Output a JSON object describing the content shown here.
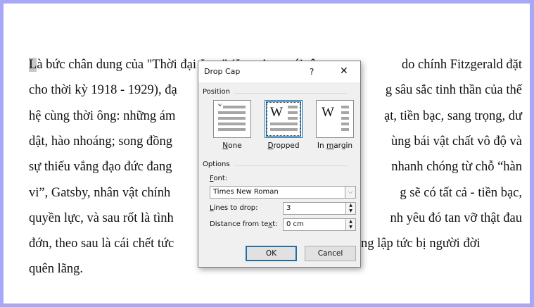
{
  "document": {
    "drop_cap_letter": "L",
    "lines": [
      {
        "left": "à bức chân dung của \"Thời đại Jazz\" (Jazz Age, cái tên",
        "right": "do chính Fitzgerald đặt"
      },
      {
        "left": "cho thời kỳ 1918 - 1929), đạ",
        "right": "g sâu sắc tinh thần của thế"
      },
      {
        "left": "hệ cùng thời ông: những ám",
        "right": "ạt, tiền bạc, sang trọng, dư"
      },
      {
        "left": "dật, hào nhoáng; song đồng",
        "right": "ùng bái vật chất vô độ và"
      },
      {
        "left": "sự thiếu vắng đạo đức đang",
        "right": "nhanh chóng từ chỗ “hàn"
      },
      {
        "left": "vi”, Gatsby, nhân vật chính",
        "right": "g sẽ có tất cả - tiền bạc,"
      },
      {
        "left": "quyền lực, và sau rốt là  tình",
        "right": "nh yêu đó tan vỡ thật đau"
      },
      {
        "left": "đớn, theo sau là cái chết tức",
        "right": "ng lập tức bị người đời"
      },
      {
        "left": "quên lãng.",
        "right": ""
      }
    ]
  },
  "dialog": {
    "title": "Drop Cap",
    "help": "?",
    "close": "✕",
    "position_label": "Position",
    "positions": [
      {
        "label": "None",
        "key": "N",
        "rest": "one"
      },
      {
        "label": "Dropped",
        "key": "D",
        "rest": "ropped"
      },
      {
        "label": "In margin",
        "pre": "In ",
        "key": "m",
        "rest": "argin"
      }
    ],
    "selected_position": "Dropped",
    "options_label": "Options",
    "font_label_key": "F",
    "font_label_rest": "ont:",
    "font_value": "Times New Roman",
    "lines_label_key": "L",
    "lines_label_rest": "ines to drop:",
    "lines_value": "3",
    "distance_label_pre": "Distance from te",
    "distance_label_key": "x",
    "distance_label_rest": "t:",
    "distance_value": "0 cm",
    "ok": "OK",
    "cancel": "Cancel"
  }
}
